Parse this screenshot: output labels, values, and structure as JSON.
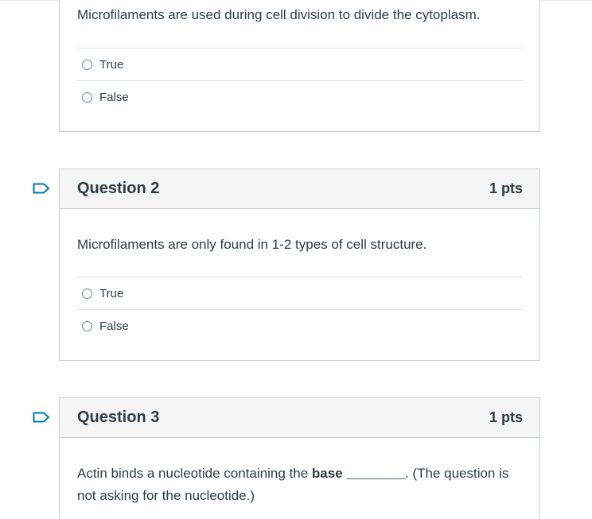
{
  "questions": [
    {
      "text": "Microfilaments are used during cell division to divide the cytoplasm.",
      "answers": [
        "True",
        "False"
      ]
    },
    {
      "title": "Question 2",
      "points": "1 pts",
      "text": "Microfilaments are only found in 1-2 types of cell structure.",
      "answers": [
        "True",
        "False"
      ]
    },
    {
      "title": "Question 3",
      "points": "1 pts",
      "text_before": "Actin binds a nucleotide containing the ",
      "text_bold": "base",
      "text_blank": "________",
      "text_after": ". (The question is not asking for the nucleotide.)"
    }
  ],
  "colors": {
    "flag_stroke": "#0374b5",
    "header_bg": "#f5f5f5",
    "border": "#c7cdd1"
  },
  "icons": {
    "flag": "flag-bookmark-icon",
    "radio": "radio-empty-icon"
  }
}
